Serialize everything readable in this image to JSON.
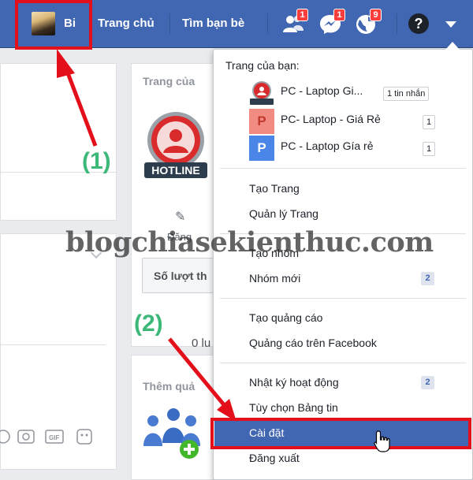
{
  "topbar": {
    "profile_name": "Bi",
    "nav": [
      "Trang chủ",
      "Tìm bạn bè"
    ],
    "badges": {
      "friend_requests": "1",
      "messages": "1",
      "notifications": "9"
    },
    "colors": {
      "bar": "#4267b2",
      "badge": "#fa3e3e"
    }
  },
  "background": {
    "section_title": "Trang của",
    "post_action_label": "Đăng",
    "stat_button": "Số lượt th",
    "zero_label": "0 lu",
    "add_label": "Thêm quả"
  },
  "menu": {
    "heading": "Trang của bạn:",
    "pages": [
      {
        "name": "PC - Laptop Gi...",
        "count": "1 tin nhắn",
        "icon": "hotline-logo"
      },
      {
        "name": "PC- Laptop - Giá Rẻ",
        "count": "1",
        "icon_letter": "P"
      },
      {
        "name": "PC - Laptop Gía rẻ",
        "count": "1",
        "icon_letter": "P"
      }
    ],
    "items": {
      "create_page": "Tạo Trang",
      "manage_pages": "Quản lý Trang",
      "create_group": "Tạo nhóm",
      "new_groups": "Nhóm mới",
      "new_groups_count": "2",
      "create_ad": "Tạo quảng cáo",
      "ads_on_facebook": "Quảng cáo trên Facebook",
      "activity_log": "Nhật ký hoạt động",
      "activity_log_count": "2",
      "news_feed_prefs": "Tùy chọn Bảng tin",
      "settings": "Cài đặt",
      "log_out": "Đăng xuất"
    }
  },
  "annotations": {
    "watermark": "blogchiasekienthuc.com",
    "step1": "(1)",
    "step2": "(2)",
    "highlight_color": "#e3101b",
    "label_color": "#3cb878"
  }
}
